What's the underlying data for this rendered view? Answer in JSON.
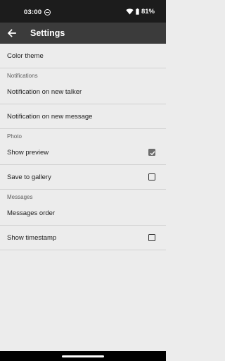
{
  "status_bar": {
    "time": "03:00",
    "battery": "81%",
    "icons": [
      "dnd-icon",
      "wifi-icon",
      "battery-icon"
    ]
  },
  "app_bar": {
    "title": "Settings",
    "back_icon": "arrow-back-icon"
  },
  "settings": {
    "color_theme": "Color theme",
    "notifications_header": "Notifications",
    "notify_new_talker": "Notification on new talker",
    "notify_new_message": "Notification on new message",
    "photo_header": "Photo",
    "show_preview": {
      "label": "Show preview",
      "checked": true
    },
    "save_to_gallery": {
      "label": "Save to gallery",
      "checked": false
    },
    "messages_header": "Messages",
    "messages_order": "Messages order",
    "show_timestamp": {
      "label": "Show timestamp",
      "checked": false
    }
  },
  "colors": {
    "status_bar_bg": "#1c1c1c",
    "app_bar_bg": "#3b3b3b",
    "page_bg": "#ececec",
    "checkbox_checked": "#6d6d6d"
  }
}
